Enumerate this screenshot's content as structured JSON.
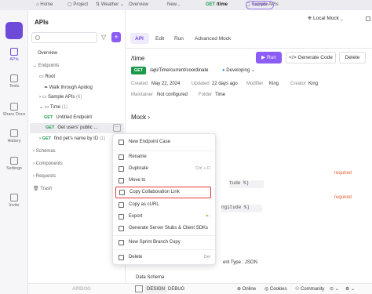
{
  "titlebar": {
    "tabs": [
      "Home",
      "Project",
      "Weather",
      "Overview",
      "New...",
      "/time",
      "Sample APIs"
    ],
    "get_badge": "GET",
    "upgrade": "Upgrade"
  },
  "rail": [
    {
      "label": "APIs",
      "icon": "apis-icon"
    },
    {
      "label": "Tests",
      "icon": "tests-icon"
    },
    {
      "label": "Share Docs",
      "icon": "share-docs-icon"
    },
    {
      "label": "History",
      "icon": "history-icon"
    },
    {
      "label": "Settings",
      "icon": "settings-icon"
    },
    {
      "label": "Invite",
      "icon": "invite-icon"
    }
  ],
  "sidebar": {
    "title": "APIs",
    "search_placeholder": "Search",
    "items": {
      "overview": "Overview",
      "endpoints": "Endpoints",
      "root": "Root",
      "walk": "Walk through Apidog",
      "sample": "Sample APIs",
      "sample_count": "(6)",
      "time": "Time",
      "time_count": "(1)",
      "untitled": "Untitled Endpoint",
      "get_users": "Get users' public ...",
      "find_pets": "find pet's name by ID",
      "find_pets_count": "(1)",
      "schemas": "Schemas",
      "components": "Components",
      "requests": "Requests",
      "trash": "Trash"
    },
    "method": "GET"
  },
  "main": {
    "env": "Local Mock",
    "tabs": [
      "API",
      "Edit",
      "Run",
      "Advanced Mock"
    ],
    "path_title": "/time",
    "run": "Run",
    "generate_code": "Generate Code",
    "delete": "Delete",
    "method": "GET",
    "endpoint_path": "/api/Time/current/coordinate",
    "status": "Developing",
    "created_label": "Created",
    "created": "May 22, 2024",
    "updated_label": "Updated",
    "updated": "22 days ago",
    "modifier_label": "Modifier",
    "modifier": "King",
    "creator_label": "Creator",
    "creator": "King",
    "maintainer_label": "Maintainer",
    "maintainer": "Not configured",
    "folder_label": "Folder",
    "folder": "Time",
    "mock_section": "Mock",
    "required1": "required",
    "required2": "required",
    "field1": "tude %)",
    "field2": "ngitude %)",
    "content_type": "ent Type : JSON",
    "data_schema": "Data Schema"
  },
  "context_menu": {
    "items": [
      {
        "label": "New Endpoint Case",
        "icon": "new-case-icon",
        "shortcut": ""
      },
      {
        "label": "Rename",
        "icon": "rename-icon",
        "shortcut": ""
      },
      {
        "label": "Duplicate",
        "icon": "duplicate-icon",
        "shortcut": "Ctrl + D"
      },
      {
        "label": "Move to",
        "icon": "move-icon",
        "shortcut": ""
      },
      {
        "label": "Copy Collaboration Link",
        "icon": "link-icon",
        "shortcut": ""
      },
      {
        "label": "Copy as cURL",
        "icon": "curl-icon",
        "shortcut": ""
      },
      {
        "label": "Export",
        "icon": "export-icon",
        "shortcut": ""
      },
      {
        "label": "Generate Server Stubs & Client SDKs",
        "icon": "generate-icon",
        "shortcut": ""
      },
      {
        "label": "New Sprint Branch Copy",
        "icon": "branch-icon",
        "shortcut": ""
      },
      {
        "label": "Delete",
        "icon": "delete-icon",
        "shortcut": "Del"
      }
    ]
  },
  "statusbar": {
    "logo": "APIDOG",
    "design": "DESIGN",
    "debug": "DEBUG",
    "online": "Online",
    "cookies": "Cookies",
    "community": "Community"
  },
  "colors": {
    "accent": "#8b5cf6",
    "get": "#1a9a4a",
    "required": "#e35d2b",
    "highlight": "#e53935"
  }
}
